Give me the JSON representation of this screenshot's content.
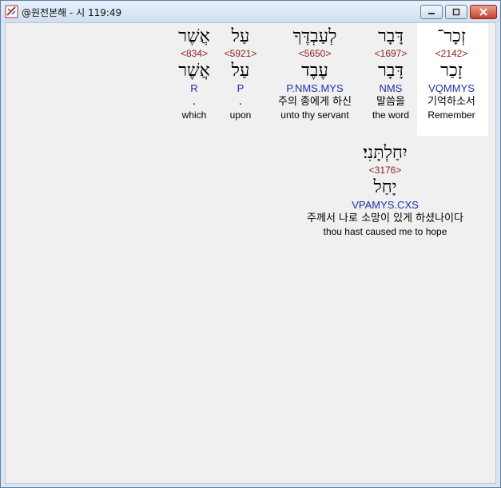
{
  "window": {
    "title": "@원전본해 - 시 119:49"
  },
  "words": [
    {
      "hebrew": "זְכָר־",
      "strong": "<2142>",
      "lemma": "זָכַר",
      "morph": "VQMMYS",
      "korean": "기억하소서",
      "english": "Remember"
    },
    {
      "hebrew": "דָּבָר",
      "strong": "<1697>",
      "lemma": "דָּבָר",
      "morph": "NMS",
      "korean": "말씀을",
      "english": "the word"
    },
    {
      "hebrew": "לְעַבְדֶּךָ",
      "strong": "<5650>",
      "lemma": "עֶבֶד",
      "morph": "P.NMS.MYS",
      "korean": "주의 종에게 하신",
      "english": "unto thy servant"
    },
    {
      "hebrew": "עַל",
      "strong": "<5921>",
      "lemma": "עַל",
      "morph": "P",
      "korean": ".",
      "english": "upon"
    },
    {
      "hebrew": "אֲשֶׁר",
      "strong": "<834>",
      "lemma": "אֲשֶׁר",
      "morph": "R",
      "korean": ".",
      "english": "which"
    },
    {
      "hebrew": "יִחַלְתָּנִי׃",
      "strong": "<3176>",
      "lemma": "יָחַל",
      "morph": "VPAMYS.CXS",
      "korean": "주께서 나로 소망이 있게 하셨나이다",
      "english": "thou hast caused me to hope"
    }
  ]
}
